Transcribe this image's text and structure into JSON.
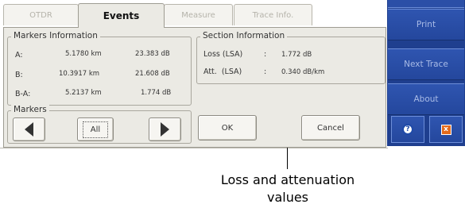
{
  "tabs": {
    "otdr": "OTDR",
    "events": "Events",
    "measure": "Measure",
    "trace_info": "Trace Info."
  },
  "markers_info": {
    "title": "Markers Information",
    "rows": [
      {
        "label": "A:",
        "distance": "5.1780 km",
        "value": "23.383 dB"
      },
      {
        "label": "B:",
        "distance": "10.3917 km",
        "value": "21.608 dB"
      },
      {
        "label": "B-A:",
        "distance": "5.2137 km",
        "value": "1.774 dB"
      }
    ]
  },
  "section_info": {
    "title": "Section Information",
    "rows": [
      {
        "label": "Loss (LSA)",
        "sep": ":",
        "value": "1.772 dB"
      },
      {
        "label": "Att.  (LSA)",
        "sep": ":",
        "value": "0.340 dB/km"
      }
    ]
  },
  "markers": {
    "title": "Markers",
    "all_label": "All"
  },
  "buttons": {
    "ok": "OK",
    "cancel": "Cancel"
  },
  "sidebar": {
    "print": "Print",
    "next_trace": "Next Trace",
    "about": "About",
    "help_icon": "?",
    "close_icon": "x"
  },
  "callout": {
    "line1": "Loss and attenuation",
    "line2": "values"
  },
  "colors": {
    "sidebar": "#1f3f8f",
    "panel": "#ebeae4",
    "close_accent": "#e46a1c"
  }
}
